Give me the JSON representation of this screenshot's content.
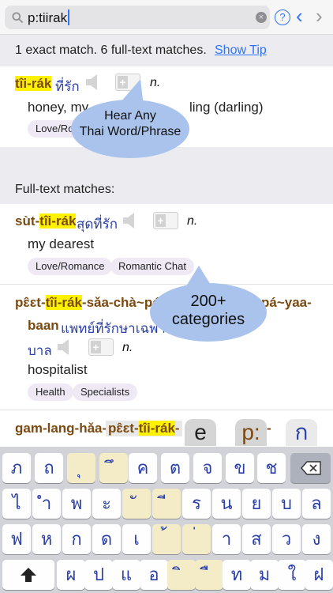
{
  "search": {
    "query": "p:tiirak",
    "clear_glyph": "×",
    "help_glyph": "?",
    "back_glyph": "‹",
    "forward_glyph": "›"
  },
  "summary": {
    "text": "1 exact match. 6 full-text matches.",
    "show_tip": "Show Tip"
  },
  "exact": {
    "translit": "tîi-rák",
    "thai": "ที่รัก",
    "pos": "n.",
    "meaning_visible_start": "honey, my",
    "meaning_visible_end": "ling (darling)",
    "tag_visible": "Love/Ro"
  },
  "section_title": "Full-text matches:",
  "entries": [
    {
      "translit_pre": "sùt-",
      "translit_hl": "tîi-rák",
      "thai": "สุดที่รัก",
      "pos": "n.",
      "meaning": "my dearest",
      "tags": [
        "Love/Romance",
        "Romantic Chat"
      ]
    },
    {
      "translit_pre": "pɛ̂ɛt-",
      "translit_hl": "tîi-rák",
      "translit_post": "-sǎa-chà~pó",
      "translit_end": "pá~yaa-",
      "line2_translit": "baan",
      "line2_thai": "แพทย์ที่รักษาเฉพาะค",
      "line3_thai": "บาล",
      "pos": "n.",
      "meaning": "hospitalist",
      "tags": [
        "Health",
        "Specialists"
      ]
    },
    {
      "translit_pre": "gam-lang-hǎa-",
      "overlay_pre": "pɛ̂ɛt-",
      "overlay_hl": "tîi-rák",
      "overlay_post": "-",
      "overlay_end": "-"
    }
  ],
  "callouts": {
    "hear": [
      "Hear Any",
      "Thai Word/Phrase"
    ],
    "categories": [
      "200+",
      "categories"
    ]
  },
  "keyboard_tabs": [
    "e",
    "p:",
    "ก"
  ],
  "keyboard": {
    "row1": [
      "ภ",
      "ถ",
      "ุ",
      "ึ",
      "ค",
      "ต",
      "จ",
      "ข",
      "ช"
    ],
    "row2": [
      "ไ",
      "ำ",
      "พ",
      "ะ",
      "ั",
      "ี",
      "ร",
      "น",
      "ย",
      "บ",
      "ล"
    ],
    "row3": [
      "ฟ",
      "ห",
      "ก",
      "ด",
      "เ",
      "้",
      "่",
      "า",
      "ส",
      "ว",
      "ง"
    ],
    "row4": [
      "ผ",
      "ป",
      "แ",
      "อ",
      "ิ",
      "ื",
      "ท",
      "ม",
      "ใ",
      "ฝ"
    ]
  },
  "colors": {
    "accent": "#2f74f6",
    "translit": "#7a4a12",
    "thai": "#2a3fa8",
    "highlight": "#fff200",
    "tag_bg": "#efe9f6",
    "callout": "#a9c3ec"
  },
  "icons": [
    "search-icon",
    "clear-icon",
    "help-icon",
    "chevron-left-icon",
    "chevron-right-icon",
    "speaker-icon",
    "add-to-list-icon",
    "shift-icon",
    "backspace-icon"
  ]
}
